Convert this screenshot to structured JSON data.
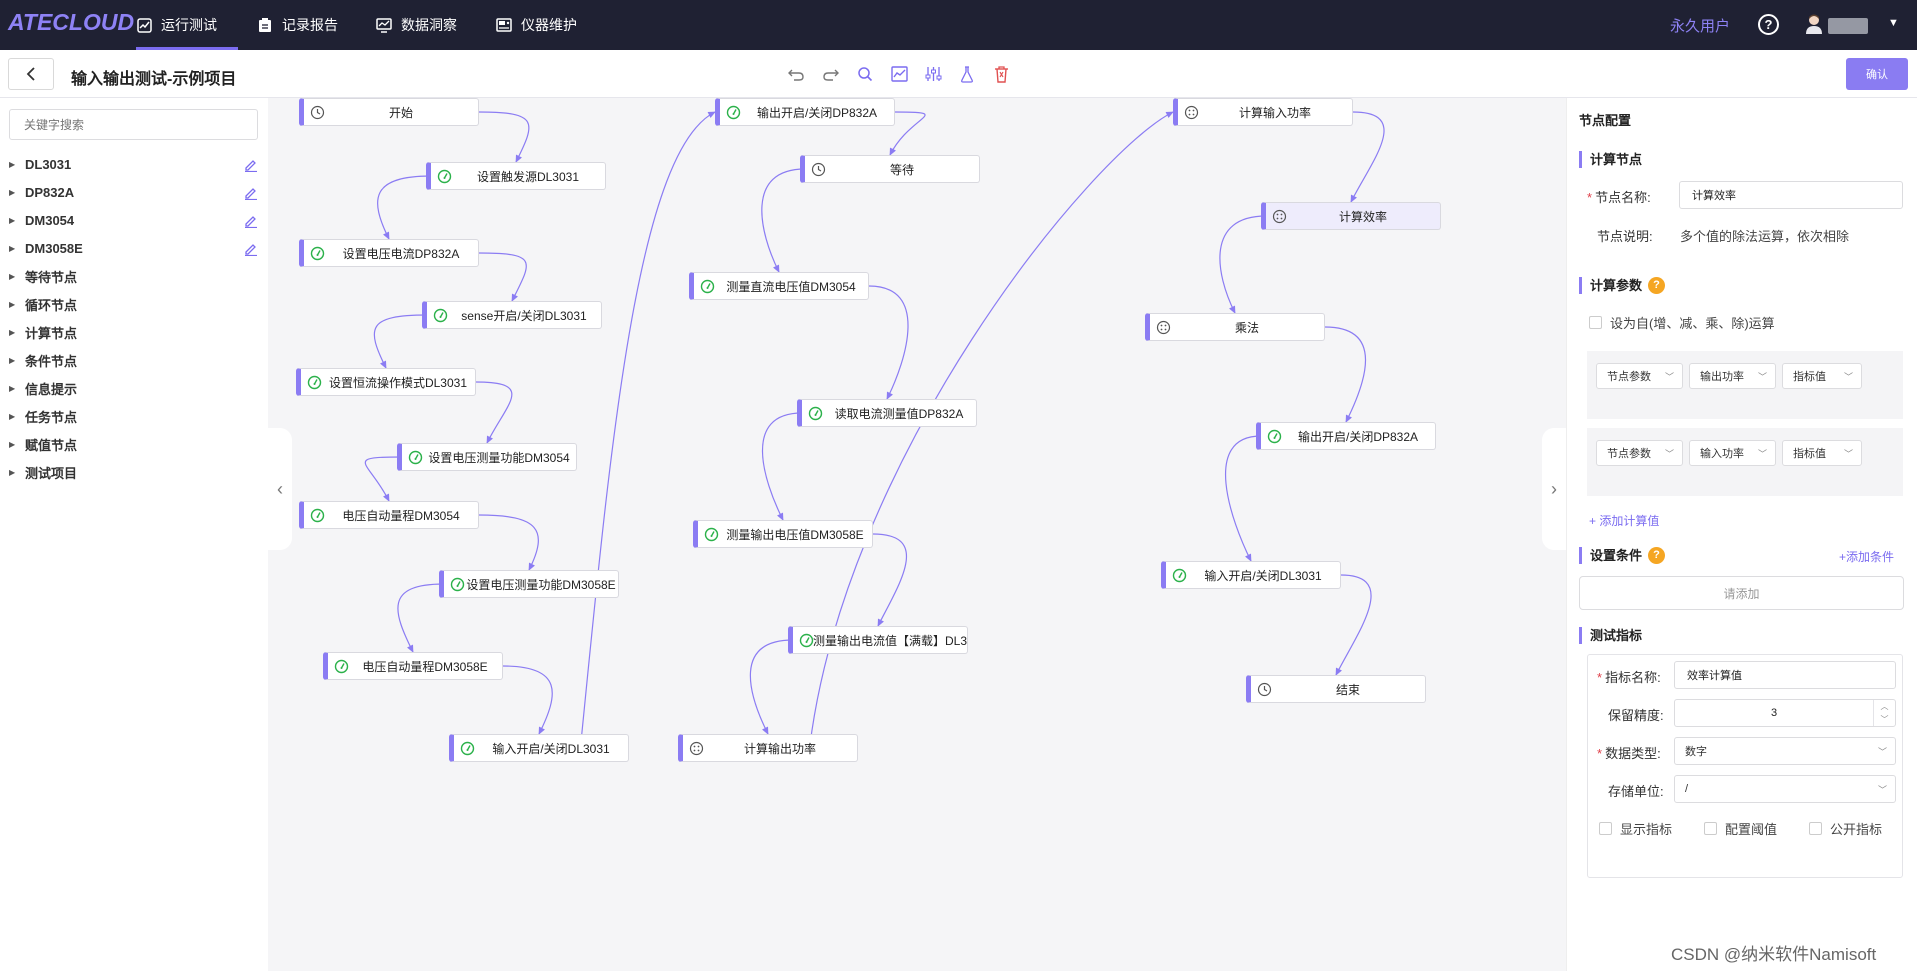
{
  "nav": {
    "logo": "ATECLOUD",
    "tabs": [
      {
        "label": "运行测试",
        "icon": "chart-icon",
        "active": true
      },
      {
        "label": "记录报告",
        "icon": "clipboard-icon"
      },
      {
        "label": "数据洞察",
        "icon": "monitor-chart-icon"
      },
      {
        "label": "仪器维护",
        "icon": "instrument-icon"
      }
    ],
    "user_type": "永久用户",
    "help": "?"
  },
  "toolbar": {
    "title": "输入输出测试-示例项目",
    "icons": [
      "undo-icon",
      "redo-icon",
      "search-icon",
      "chart-icon",
      "sliders-icon",
      "flask-icon",
      "delete-icon"
    ],
    "confirm_label": "确认"
  },
  "sidebar": {
    "search_placeholder": "关键字搜索",
    "items": [
      {
        "label": "DL3031",
        "editable": true
      },
      {
        "label": "DP832A",
        "editable": true
      },
      {
        "label": "DM3054",
        "editable": true
      },
      {
        "label": "DM3058E",
        "editable": true
      },
      {
        "label": "等待节点"
      },
      {
        "label": "循环节点"
      },
      {
        "label": "计算节点"
      },
      {
        "label": "条件节点"
      },
      {
        "label": "信息提示"
      },
      {
        "label": "任务节点"
      },
      {
        "label": "赋值节点"
      },
      {
        "label": "测试项目"
      }
    ]
  },
  "flow": {
    "nodes": [
      {
        "label": "开始",
        "icon": "clock-icon"
      },
      {
        "label": "设置触发源DL3031",
        "icon": "gauge-icon"
      },
      {
        "label": "设置电压电流DP832A",
        "icon": "gauge-icon"
      },
      {
        "label": "sense开启/关闭DL3031",
        "icon": "gauge-icon"
      },
      {
        "label": "设置恒流操作模式DL3031",
        "icon": "gauge-icon"
      },
      {
        "label": "设置电压测量功能DM3054",
        "icon": "gauge-icon"
      },
      {
        "label": "电压自动量程DM3054",
        "icon": "gauge-icon"
      },
      {
        "label": "设置电压测量功能DM3058E",
        "icon": "gauge-icon"
      },
      {
        "label": "电压自动量程DM3058E",
        "icon": "gauge-icon"
      },
      {
        "label": "输入开启/关闭DL3031",
        "icon": "gauge-icon"
      },
      {
        "label": "输出开启/关闭DP832A",
        "icon": "gauge-icon"
      },
      {
        "label": "等待",
        "icon": "clock-icon"
      },
      {
        "label": "测量直流电压值DM3054",
        "icon": "gauge-icon"
      },
      {
        "label": "读取电流测量值DP832A",
        "icon": "gauge-icon"
      },
      {
        "label": "测量输出电压值DM3058E",
        "icon": "gauge-icon"
      },
      {
        "label": "测量输出电流值【满载】DL3",
        "icon": "gauge-icon"
      },
      {
        "label": "计算输出功率",
        "icon": "calc-icon"
      },
      {
        "label": "计算输入功率",
        "icon": "calc-icon"
      },
      {
        "label": "计算效率",
        "icon": "calc-icon",
        "selected": true
      },
      {
        "label": "乘法",
        "icon": "calc-icon"
      },
      {
        "label": "输出开启/关闭DP832A",
        "icon": "gauge-icon"
      },
      {
        "label": "输入开启/关闭DL3031",
        "icon": "gauge-icon"
      },
      {
        "label": "结束",
        "icon": "clock-icon"
      }
    ]
  },
  "panel": {
    "title": "节点配置",
    "calc_node": {
      "section": "计算节点",
      "name_label": "节点名称:",
      "name_value": "计算效率",
      "desc_label": "节点说明:",
      "desc_value": "多个值的除法运算，依次相除"
    },
    "calc_params": {
      "section": "计算参数",
      "self_op_label": "设为自(增、减、乘、除)运算",
      "rows": [
        {
          "a": "节点参数",
          "b": "输出功率",
          "c": "指标值"
        },
        {
          "a": "节点参数",
          "b": "输入功率",
          "c": "指标值"
        }
      ],
      "add_label": "+ 添加计算值"
    },
    "conditions": {
      "section": "设置条件",
      "add_label": "+添加条件",
      "empty_label": "请添加"
    },
    "metrics": {
      "section": "测试指标",
      "name_label": "指标名称:",
      "name_value": "效率计算值",
      "precision_label": "保留精度:",
      "precision_value": "3",
      "type_label": "数据类型:",
      "type_value": "数字",
      "unit_label": "存储单位:",
      "unit_value": "/",
      "checkboxes": [
        "显示指标",
        "配置阈值",
        "公开指标"
      ]
    }
  },
  "watermark": "CSDN @纳米软件Namisoft",
  "colors": {
    "accent": "#8b7cf3",
    "nav_bg": "#1f2133",
    "gauge_green": "#2bb14a",
    "warning": "#f5a623"
  }
}
